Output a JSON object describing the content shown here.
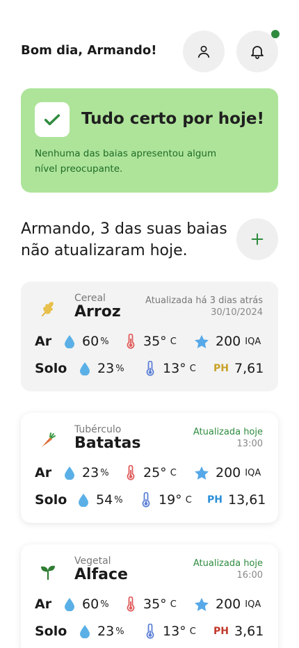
{
  "header": {
    "greeting": "Bom dia, Armando!"
  },
  "banner": {
    "title": "Tudo certo por hoje!",
    "text": "Nenhuma das baias apresentou algum nível preocupante.",
    "color": "#aee49a"
  },
  "section": {
    "title": "Armando, 3 das suas baias não atualizaram hoje."
  },
  "cards": [
    {
      "category": "Cereal",
      "name": "Arroz",
      "icon": "wheat-icon",
      "updated_label": "Atualizada há 3 dias atrás",
      "updated_time": "30/10/2024",
      "air_label": "Ar",
      "soil_label": "Solo",
      "air_humidity": "60",
      "air_humidity_unit": "%",
      "air_temp": "35°",
      "air_temp_unit": "C",
      "air_quality": "200",
      "air_quality_unit": "IQA",
      "soil_humidity": "23",
      "soil_humidity_unit": "%",
      "soil_temp": "13°",
      "soil_temp_unit": "C",
      "ph_label": "PH",
      "ph_value": "7,61",
      "ph_color": "#c9a227"
    },
    {
      "category": "Tubérculo",
      "name": "Batatas",
      "icon": "carrot-icon",
      "updated_label": "Atualizada hoje",
      "updated_time": "13:00",
      "air_label": "Ar",
      "soil_label": "Solo",
      "air_humidity": "23",
      "air_humidity_unit": "%",
      "air_temp": "25°",
      "air_temp_unit": "C",
      "air_quality": "200",
      "air_quality_unit": "IQA",
      "soil_humidity": "54",
      "soil_humidity_unit": "%",
      "soil_temp": "19°",
      "soil_temp_unit": "C",
      "ph_label": "PH",
      "ph_value": "13,61",
      "ph_color": "#2a8fd8"
    },
    {
      "category": "Vegetal",
      "name": "Alface",
      "icon": "sprout-icon",
      "updated_label": "Atualizada hoje",
      "updated_time": "16:00",
      "air_label": "Ar",
      "soil_label": "Solo",
      "air_humidity": "60",
      "air_humidity_unit": "%",
      "air_temp": "35°",
      "air_temp_unit": "C",
      "air_quality": "200",
      "air_quality_unit": "IQA",
      "soil_humidity": "23",
      "soil_humidity_unit": "%",
      "soil_temp": "13°",
      "soil_temp_unit": "C",
      "ph_label": "PH",
      "ph_value": "3,61",
      "ph_color": "#c0392b"
    }
  ],
  "colors": {
    "accent_green": "#2e8b3e",
    "water_blue": "#5ab0e6",
    "temp_red": "#e05a5a",
    "temp_blue": "#5b7fd6",
    "star_blue": "#56a8e8"
  }
}
